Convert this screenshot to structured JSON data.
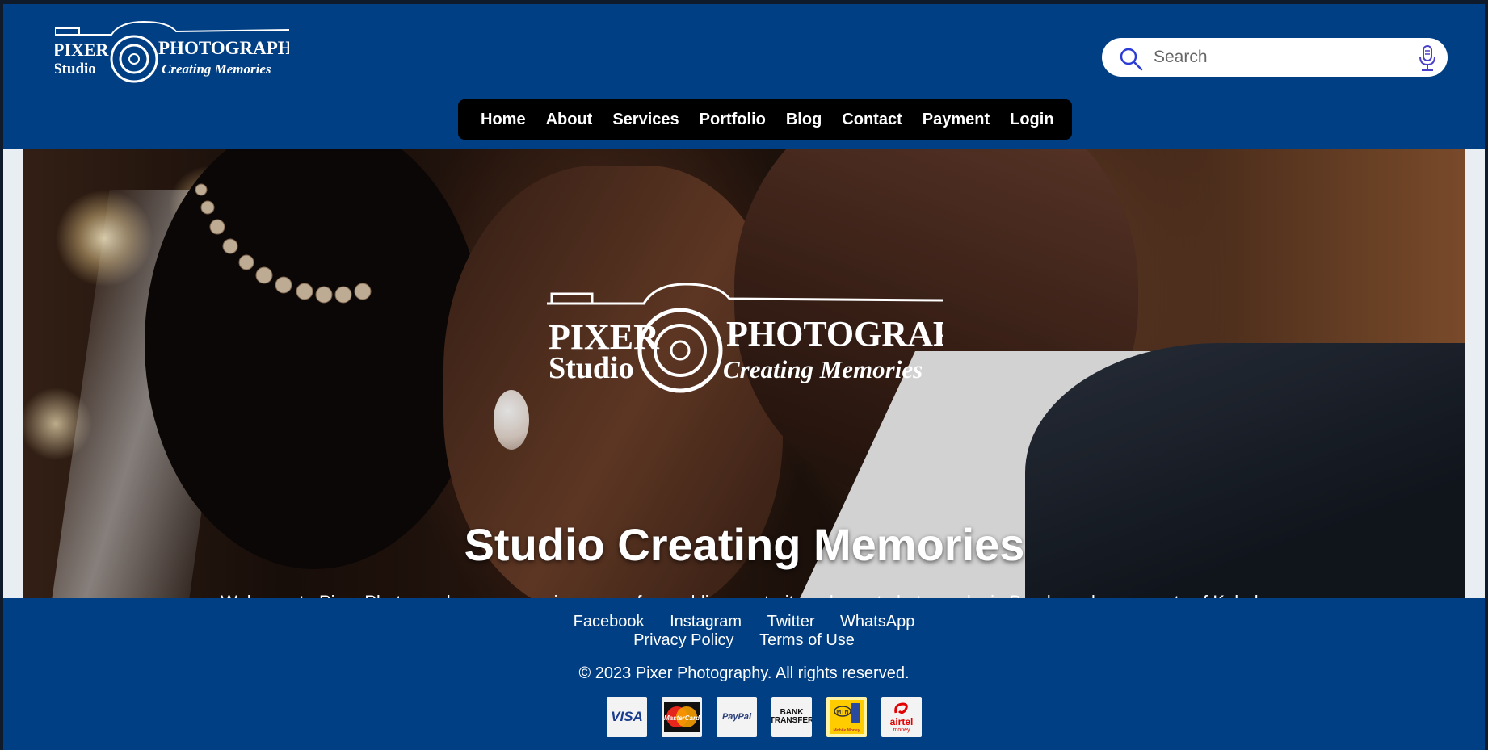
{
  "header": {
    "logo": {
      "brand_left_top": "PIXER",
      "brand_left_bottom": "Studio",
      "brand_right": "PHOTOGRAPHY",
      "tagline": "Creating Memories"
    },
    "search": {
      "placeholder": "Search",
      "search_icon": "magnifier-icon",
      "mic_icon": "microphone-icon"
    },
    "nav": {
      "items": [
        "Home",
        "About",
        "Services",
        "Portfolio",
        "Blog",
        "Contact",
        "Payment",
        "Login"
      ]
    }
  },
  "hero": {
    "logo": {
      "brand_left_top": "PIXER",
      "brand_left_bottom": "Studio",
      "brand_right": "PHOTOGRAPHY",
      "tagline": "Creating Memories"
    },
    "title": "Studio Creating Memories",
    "text": "Welcome to Pixer Photography, your premier source for wedding, portrait, and event photography in Banda and some parts of Kabale"
  },
  "footer": {
    "links_row1": [
      "Facebook",
      "Instagram",
      "Twitter",
      "WhatsApp"
    ],
    "links_row2": [
      "Privacy Policy",
      "Terms of Use"
    ],
    "copyright": "© 2023 Pixer Photography. All rights reserved.",
    "payments": {
      "visa": "VISA",
      "mastercard": "MasterCard",
      "paypal": "PayPal",
      "bank_line1": "BANK",
      "bank_line2": "TRANSFER",
      "mtn": "MTN",
      "mtn_sub": "Mobile Money",
      "airtel": "airtel",
      "airtel_sub": "money"
    }
  },
  "colors": {
    "primary": "#003f84",
    "nav_bg": "#000000",
    "text_light": "#ffffff",
    "search_icon": "#2b3bd6"
  }
}
